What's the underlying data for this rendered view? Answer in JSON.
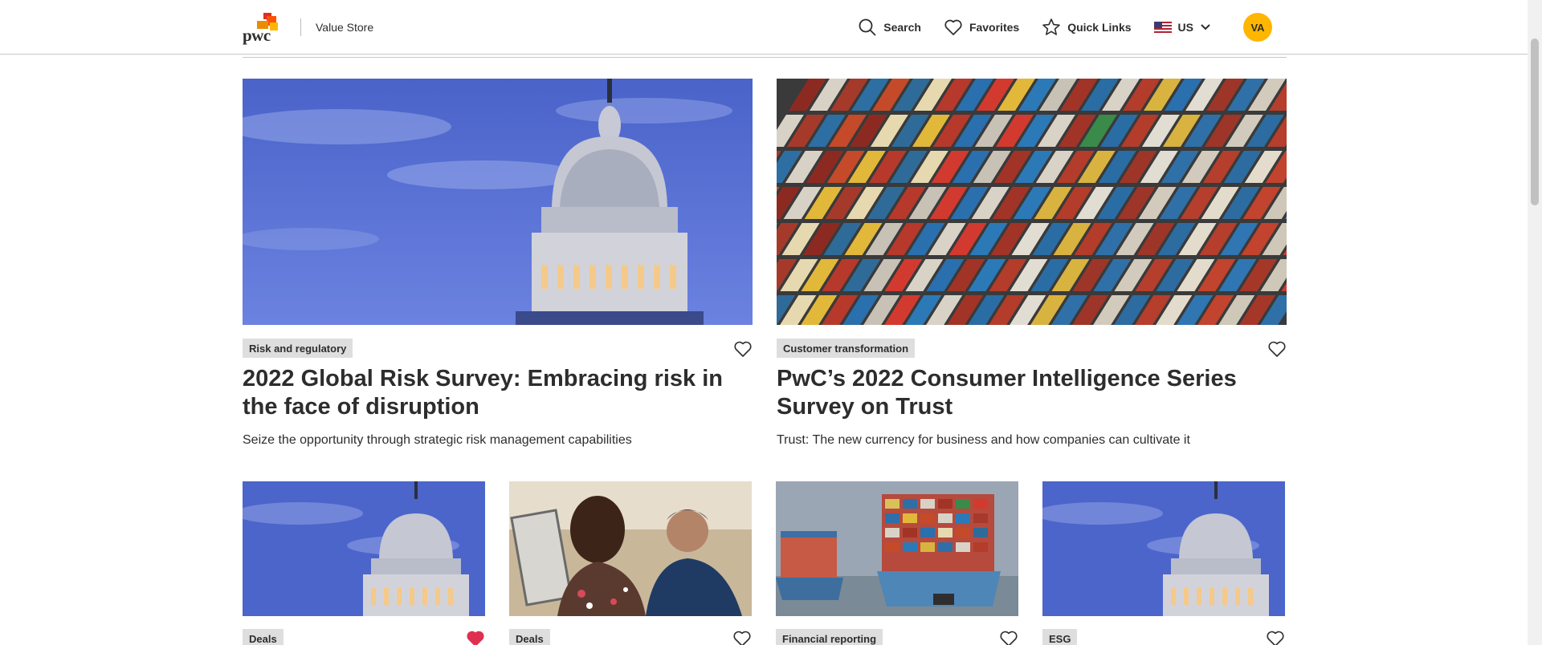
{
  "header": {
    "logo_text": "pwc",
    "store_name": "Value Store",
    "nav": {
      "search": "Search",
      "favorites": "Favorites",
      "quick_links": "Quick Links",
      "region": "US"
    },
    "avatar_initials": "VA"
  },
  "featured": [
    {
      "tag": "Risk and regulatory",
      "title": "2022 Global Risk Survey: Embracing risk in the face of disruption",
      "description": "Seize the opportunity through strategic risk management capabilities",
      "image": "capitol-dome",
      "favorited": false
    },
    {
      "tag": "Customer transformation",
      "title": "PwC’s 2022 Consumer Intelligence Series Survey on Trust",
      "description": "Trust: The new currency for business and how companies can cultivate it",
      "image": "shipping-containers",
      "favorited": false
    }
  ],
  "cards": [
    {
      "tag": "Deals",
      "image": "capitol-dome",
      "favorited": true
    },
    {
      "tag": "Deals",
      "image": "people-meeting",
      "favorited": false
    },
    {
      "tag": "Financial reporting",
      "image": "container-ships",
      "favorited": false
    },
    {
      "tag": "ESG",
      "image": "capitol-dome",
      "favorited": false
    }
  ],
  "colors": {
    "accent": "#ffb600",
    "favorite_active": "#e0304f",
    "tag_bg": "#dedede",
    "text": "#2d2d2d"
  }
}
